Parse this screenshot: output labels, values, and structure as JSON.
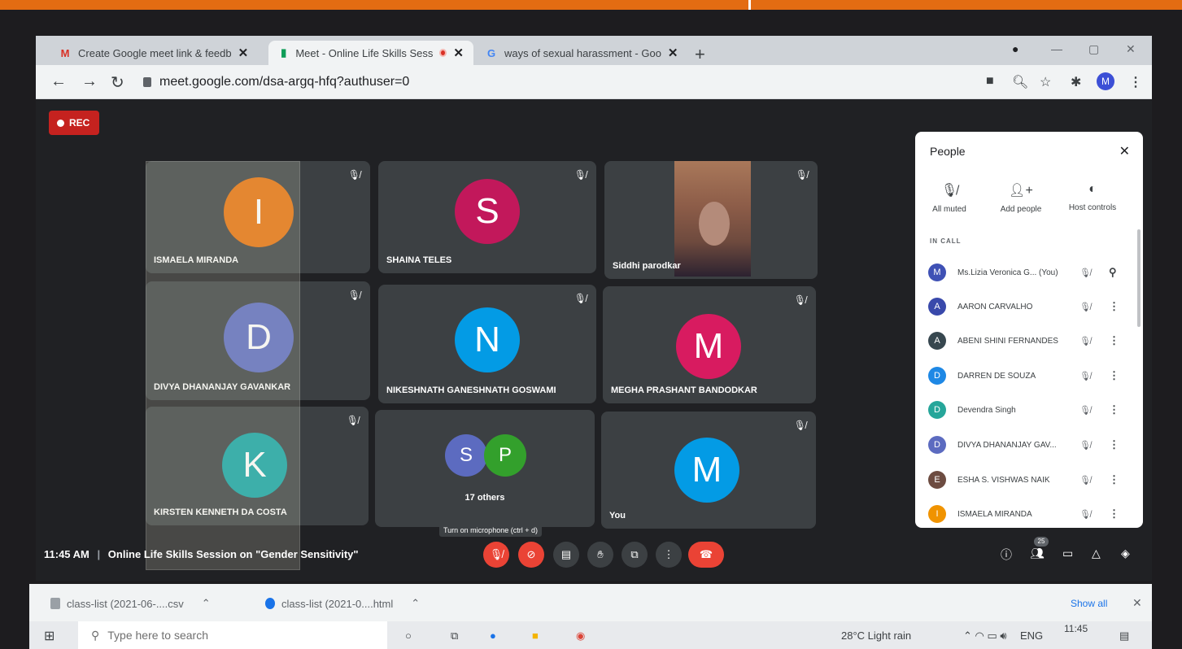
{
  "browser": {
    "tabs": [
      {
        "favicon": "M",
        "title": "Create Google meet link & feedb",
        "active": false
      },
      {
        "favicon": "meet-icon",
        "title": "Meet - Online Life Skills Sess",
        "active": true,
        "recording": true
      },
      {
        "favicon": "G",
        "title": "ways of sexual harassment - Goo",
        "active": false
      }
    ],
    "new_tab": "+",
    "url": "meet.google.com/dsa-argq-hfq?authuser=0",
    "profile_initial": "M"
  },
  "meeting": {
    "rec_label": "REC",
    "tiles": [
      {
        "name": "ISMAELA MIRANDA",
        "initial": "I",
        "color": "#e8710a"
      },
      {
        "name": "SHAINA TELES",
        "initial": "S",
        "color": "#c2185b"
      },
      {
        "name": "Siddhi parodkar",
        "initial": "",
        "color": "#8c5c48",
        "video": true
      },
      {
        "name": "DIVYA DHANANJAY GAVANKAR",
        "initial": "D",
        "color": "#5c6bc0"
      },
      {
        "name": "NIKESHNATH GANESHNATH GOSWAMI",
        "initial": "N",
        "color": "#039be5"
      },
      {
        "name": "MEGHA PRASHANT BANDODKAR",
        "initial": "M",
        "color": "#d81b60"
      },
      {
        "name": "KIRSTEN KENNETH DA COSTA",
        "initial": "K",
        "color": "#12a4a4"
      },
      {
        "name": "17 others",
        "initials": [
          "S",
          "P"
        ],
        "colors": [
          "#5c6bc0",
          "#33a02c"
        ]
      },
      {
        "name": "You",
        "initial": "M",
        "color": "#039be5"
      }
    ],
    "tooltip": "Turn on microphone (ctrl + d)",
    "time": "11:45 AM",
    "title": "Online Life Skills Session on \"Gender Sensitivity\"",
    "participant_count": "25"
  },
  "people_panel": {
    "title": "People",
    "actions": [
      {
        "label": "All muted",
        "icon": "mic-off-icon"
      },
      {
        "label": "Add people",
        "icon": "add-person-icon"
      },
      {
        "label": "Host controls",
        "icon": "toggle-icon"
      }
    ],
    "section": "IN CALL",
    "participants": [
      {
        "initial": "M",
        "name": "Ms.Lizia Veronica G...  (You)",
        "color": "#3f51b5"
      },
      {
        "initial": "A",
        "name": "AARON CARVALHO",
        "color": "#3949ab"
      },
      {
        "initial": "A",
        "name": "ABENI SHINI FERNANDES",
        "color": "#37474f"
      },
      {
        "initial": "D",
        "name": "DARREN DE SOUZA",
        "color": "#1e88e5"
      },
      {
        "initial": "D",
        "name": "Devendra Singh",
        "color": "#26a69a"
      },
      {
        "initial": "D",
        "name": "DIVYA DHANANJAY GAV...",
        "color": "#5c6bc0"
      },
      {
        "initial": "E",
        "name": "ESHA S. VISHWAS NAIK",
        "color": "#6d4c41"
      },
      {
        "initial": "I",
        "name": "ISMAELA MIRANDA",
        "color": "#f09300"
      }
    ]
  },
  "downloads": {
    "items": [
      {
        "name": "class-list (2021-06-....csv",
        "color": "#9aa0a6"
      },
      {
        "name": "class-list (2021-0....html",
        "color": "#1a73e8"
      }
    ],
    "show_all": "Show all"
  },
  "taskbar": {
    "search_placeholder": "Type here to search",
    "weather": "28°C  Light rain",
    "lang": "ENG",
    "time": "11:45"
  }
}
